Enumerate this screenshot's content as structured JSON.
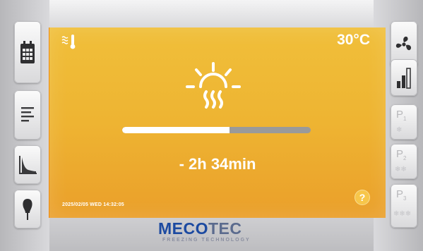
{
  "status": {
    "temperature": "30°C",
    "remaining_time": "- 2h 34min",
    "datetime": "2025/02/05 WED 14:32:05",
    "progress_fraction": 0.57,
    "help_label": "?"
  },
  "presets": [
    {
      "prefix": "P",
      "index": "1",
      "snowflakes": "❄"
    },
    {
      "prefix": "P",
      "index": "2",
      "snowflakes": "❄❄"
    },
    {
      "prefix": "P",
      "index": "3",
      "snowflakes": "❄❄❄"
    }
  ],
  "brand": {
    "name_part1": "MECO",
    "name_part2": "TEC",
    "tagline": "FREEZING TECHNOLOGY"
  },
  "icons": {
    "left": [
      "calendar-icon",
      "list-icon",
      "curve-chart-icon",
      "probe-icon"
    ],
    "right": [
      "fan-icon",
      "signal-level-icon"
    ],
    "screen": [
      "heating-mode-icon",
      "thawing-sun-icon"
    ]
  },
  "colors": {
    "screen_bg": "#f0bf3a",
    "screen_edge": "#f08a10",
    "brand_blue": "#1c4aa1"
  }
}
